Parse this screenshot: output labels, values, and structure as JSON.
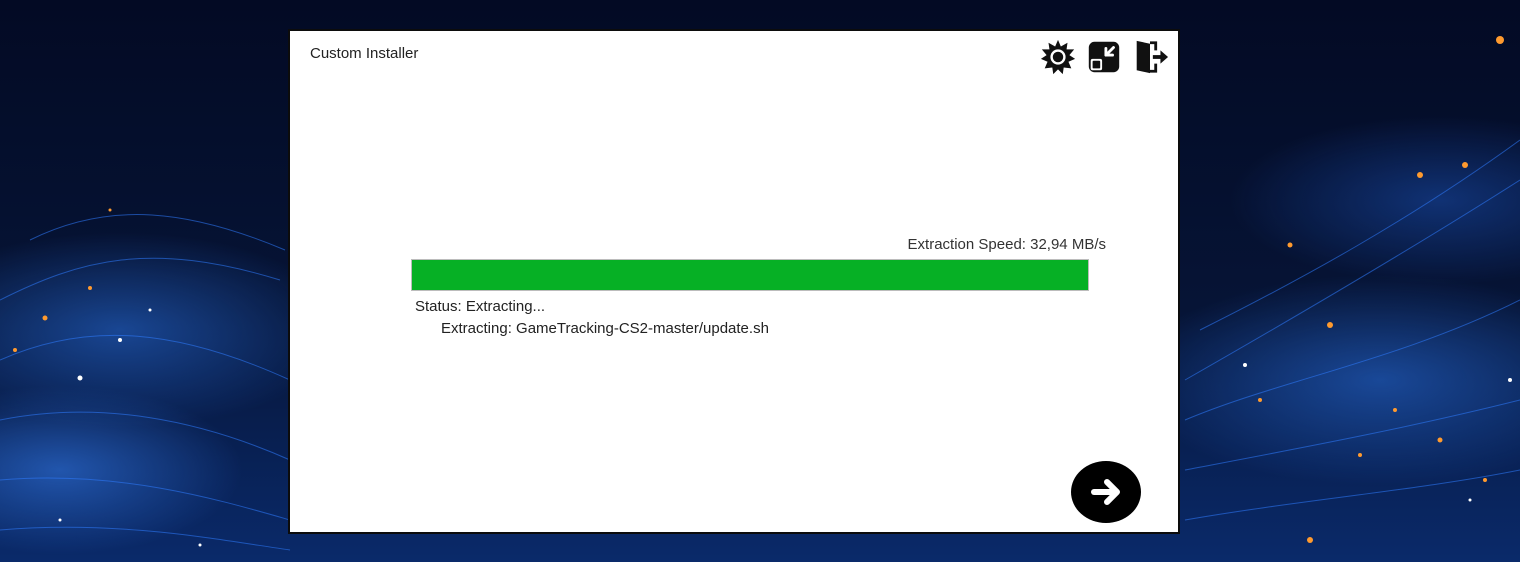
{
  "window": {
    "title": "Custom Installer"
  },
  "toolbar": {
    "settings_icon": "sun-gear-icon",
    "minimize_icon": "minimize-window-icon",
    "exit_icon": "exit-door-icon"
  },
  "progress": {
    "speed_text": "Extraction Speed: 32,94 MB/s",
    "fraction": 1.0,
    "fill_color": "#06b025",
    "status_text": "Status: Extracting...",
    "current_file_text": "Extracting: GameTracking-CS2-master/update.sh"
  },
  "next_button": {
    "icon": "arrow-right-icon"
  },
  "colors": {
    "background": "#061436",
    "window_bg": "#ffffff",
    "progress_green": "#06b025"
  }
}
